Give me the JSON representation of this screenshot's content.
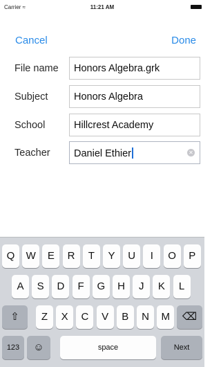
{
  "status": {
    "carrier": "Carrier",
    "time": "11:21 AM"
  },
  "nav": {
    "cancel": "Cancel",
    "done": "Done"
  },
  "form": {
    "rows": [
      {
        "label": "File name",
        "value": "Honors Algebra.grk"
      },
      {
        "label": "Subject",
        "value": "Honors Algebra"
      },
      {
        "label": "School",
        "value": "Hillcrest Academy"
      },
      {
        "label": "Teacher",
        "value": "Daniel Ethier"
      }
    ]
  },
  "keyboard": {
    "row1": [
      "Q",
      "W",
      "E",
      "R",
      "T",
      "Y",
      "U",
      "I",
      "O",
      "P"
    ],
    "row2": [
      "A",
      "S",
      "D",
      "F",
      "G",
      "H",
      "J",
      "K",
      "L"
    ],
    "row3": [
      "Z",
      "X",
      "C",
      "V",
      "B",
      "N",
      "M"
    ],
    "numbers": "123",
    "space": "space",
    "next": "Next",
    "shift_icon": "shift-icon",
    "delete_icon": "delete-icon",
    "emoji_icon": "emoji-icon"
  }
}
